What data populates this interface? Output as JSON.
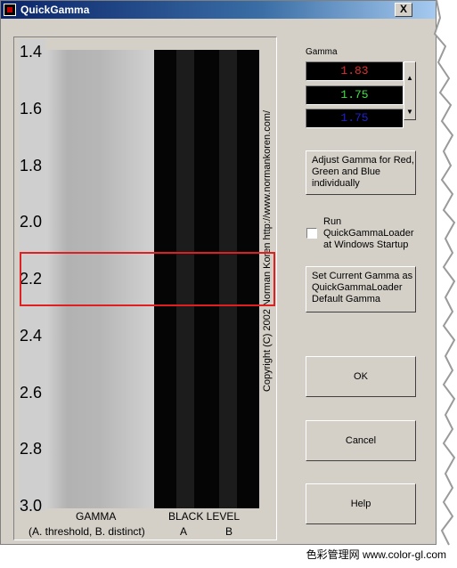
{
  "window": {
    "title": "QuickGamma",
    "close_glyph": "X"
  },
  "scale": {
    "ticks": [
      "1.4",
      "1.6",
      "1.8",
      "2.0",
      "2.2",
      "2.4",
      "2.6",
      "2.8",
      "3.0"
    ]
  },
  "chart": {
    "url_text": "Copyright (C) 2002   Norman Koren   http://www.normankoren.com/",
    "gamma_label": "GAMMA",
    "gamma_sublabel": "(A. threshold, B. distinct)",
    "black_level_label": "BLACK LEVEL",
    "a_label": "A",
    "b_label": "B"
  },
  "gamma_group": {
    "label": "Gamma",
    "red": "1.83",
    "green": "1.75",
    "blue": "1.75",
    "red_color": "#e03030",
    "green_color": "#40e040",
    "blue_color": "#2020d0"
  },
  "buttons": {
    "adjust_rgb": [
      "Adjust Gamma for Red,",
      "Green and Blue",
      "individually"
    ],
    "run_loader_label": [
      "Run",
      "QuickGammaLoader",
      "at Windows Startup"
    ],
    "set_default": [
      "Set Current Gamma as",
      "QuickGammaLoader",
      "Default Gamma"
    ],
    "ok": "OK",
    "cancel": "Cancel",
    "help": "Help"
  },
  "footer": {
    "text": "色彩管理网 www.color-gl.com"
  },
  "icons": {
    "app": "app-icon",
    "close": "close-icon",
    "spin_up": "up-arrow-icon",
    "spin_down": "down-arrow-icon"
  }
}
